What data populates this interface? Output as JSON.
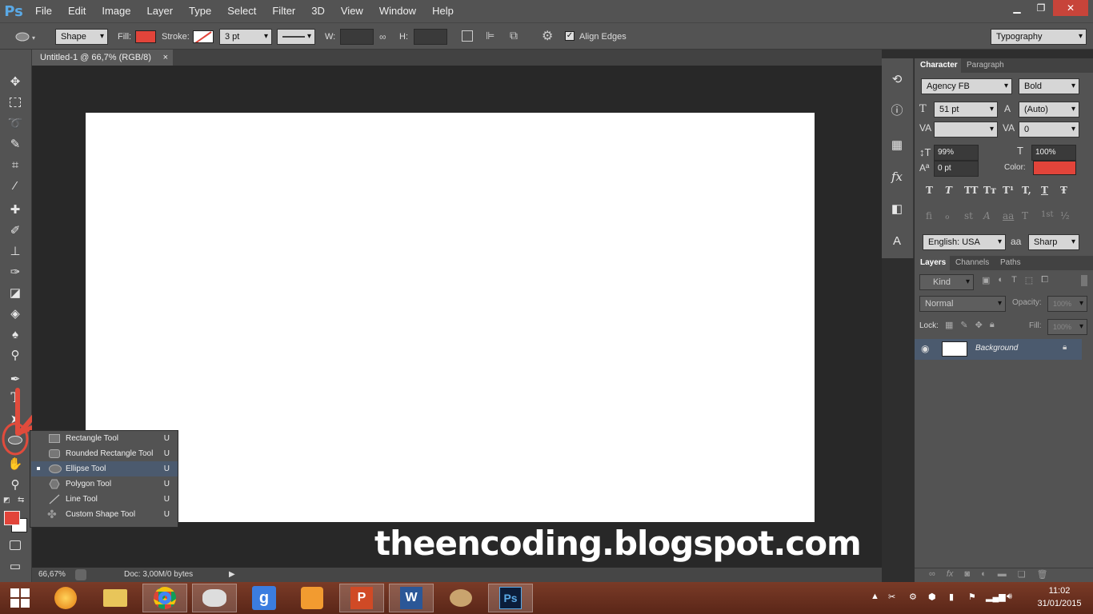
{
  "app": {
    "logo": "Ps"
  },
  "menu": [
    "File",
    "Edit",
    "Image",
    "Layer",
    "Type",
    "Select",
    "Filter",
    "3D",
    "View",
    "Window",
    "Help"
  ],
  "window_controls": {
    "minimize": "▁",
    "restore": "❐",
    "close": "✕"
  },
  "options": {
    "mode": "Shape",
    "fill_label": "Fill:",
    "stroke_label": "Stroke:",
    "stroke_width": "3 pt",
    "w_label": "W:",
    "h_label": "H:",
    "align_edges": "Align Edges",
    "workspace": "Typography",
    "fill_color": "#e2443a",
    "align_edges_checked": true
  },
  "document": {
    "tab_title": "Untitled-1 @ 66,7% (RGB/8)",
    "tab_close": "×"
  },
  "status": {
    "zoom": "66,67%",
    "doc": "Doc: 3,00M/0 bytes"
  },
  "watermark": "theencoding.blogspot.com",
  "flyout": {
    "items": [
      {
        "label": "Rectangle Tool",
        "key": "U",
        "icon": "rectangle-icon",
        "selected": false
      },
      {
        "label": "Rounded Rectangle Tool",
        "key": "U",
        "icon": "rounded-rectangle-icon",
        "selected": false
      },
      {
        "label": "Ellipse Tool",
        "key": "U",
        "icon": "ellipse-icon",
        "selected": true
      },
      {
        "label": "Polygon Tool",
        "key": "U",
        "icon": "polygon-icon",
        "selected": false
      },
      {
        "label": "Line Tool",
        "key": "U",
        "icon": "line-icon",
        "selected": false
      },
      {
        "label": "Custom Shape Tool",
        "key": "U",
        "icon": "custom-shape-icon",
        "selected": false
      }
    ]
  },
  "character": {
    "tabs": [
      "Character",
      "Paragraph"
    ],
    "font_family": "Agency FB",
    "font_style": "Bold",
    "size": "51 pt",
    "leading": "(Auto)",
    "kerning": "",
    "tracking": "0",
    "vscale": "99%",
    "hscale": "100%",
    "baseline": "0 pt",
    "color_label": "Color:",
    "color": "#e2443a",
    "language": "English: USA",
    "antialias": "Sharp",
    "aa_label": "aa",
    "style_buttons": [
      "T",
      "T",
      "TT",
      "Tт",
      "T¹",
      "T,",
      "T",
      "Ŧ"
    ],
    "opentype_buttons": [
      "fi",
      "ℴ",
      "st",
      "A",
      "aa",
      "T",
      "1st",
      "½"
    ]
  },
  "layers": {
    "tabs": [
      "Layers",
      "Channels",
      "Paths"
    ],
    "kind": "Kind",
    "blend": "Normal",
    "opacity_label": "Opacity:",
    "opacity": "100%",
    "lock_label": "Lock:",
    "fill_label": "Fill:",
    "fill": "100%",
    "items": [
      {
        "name": "Background",
        "visible": true,
        "locked": true
      }
    ]
  },
  "taskbar": {
    "clock_time": "11:02",
    "clock_date": "31/01/2015"
  },
  "colors": {
    "foreground": "#e2443a",
    "background": "#ffffff"
  }
}
